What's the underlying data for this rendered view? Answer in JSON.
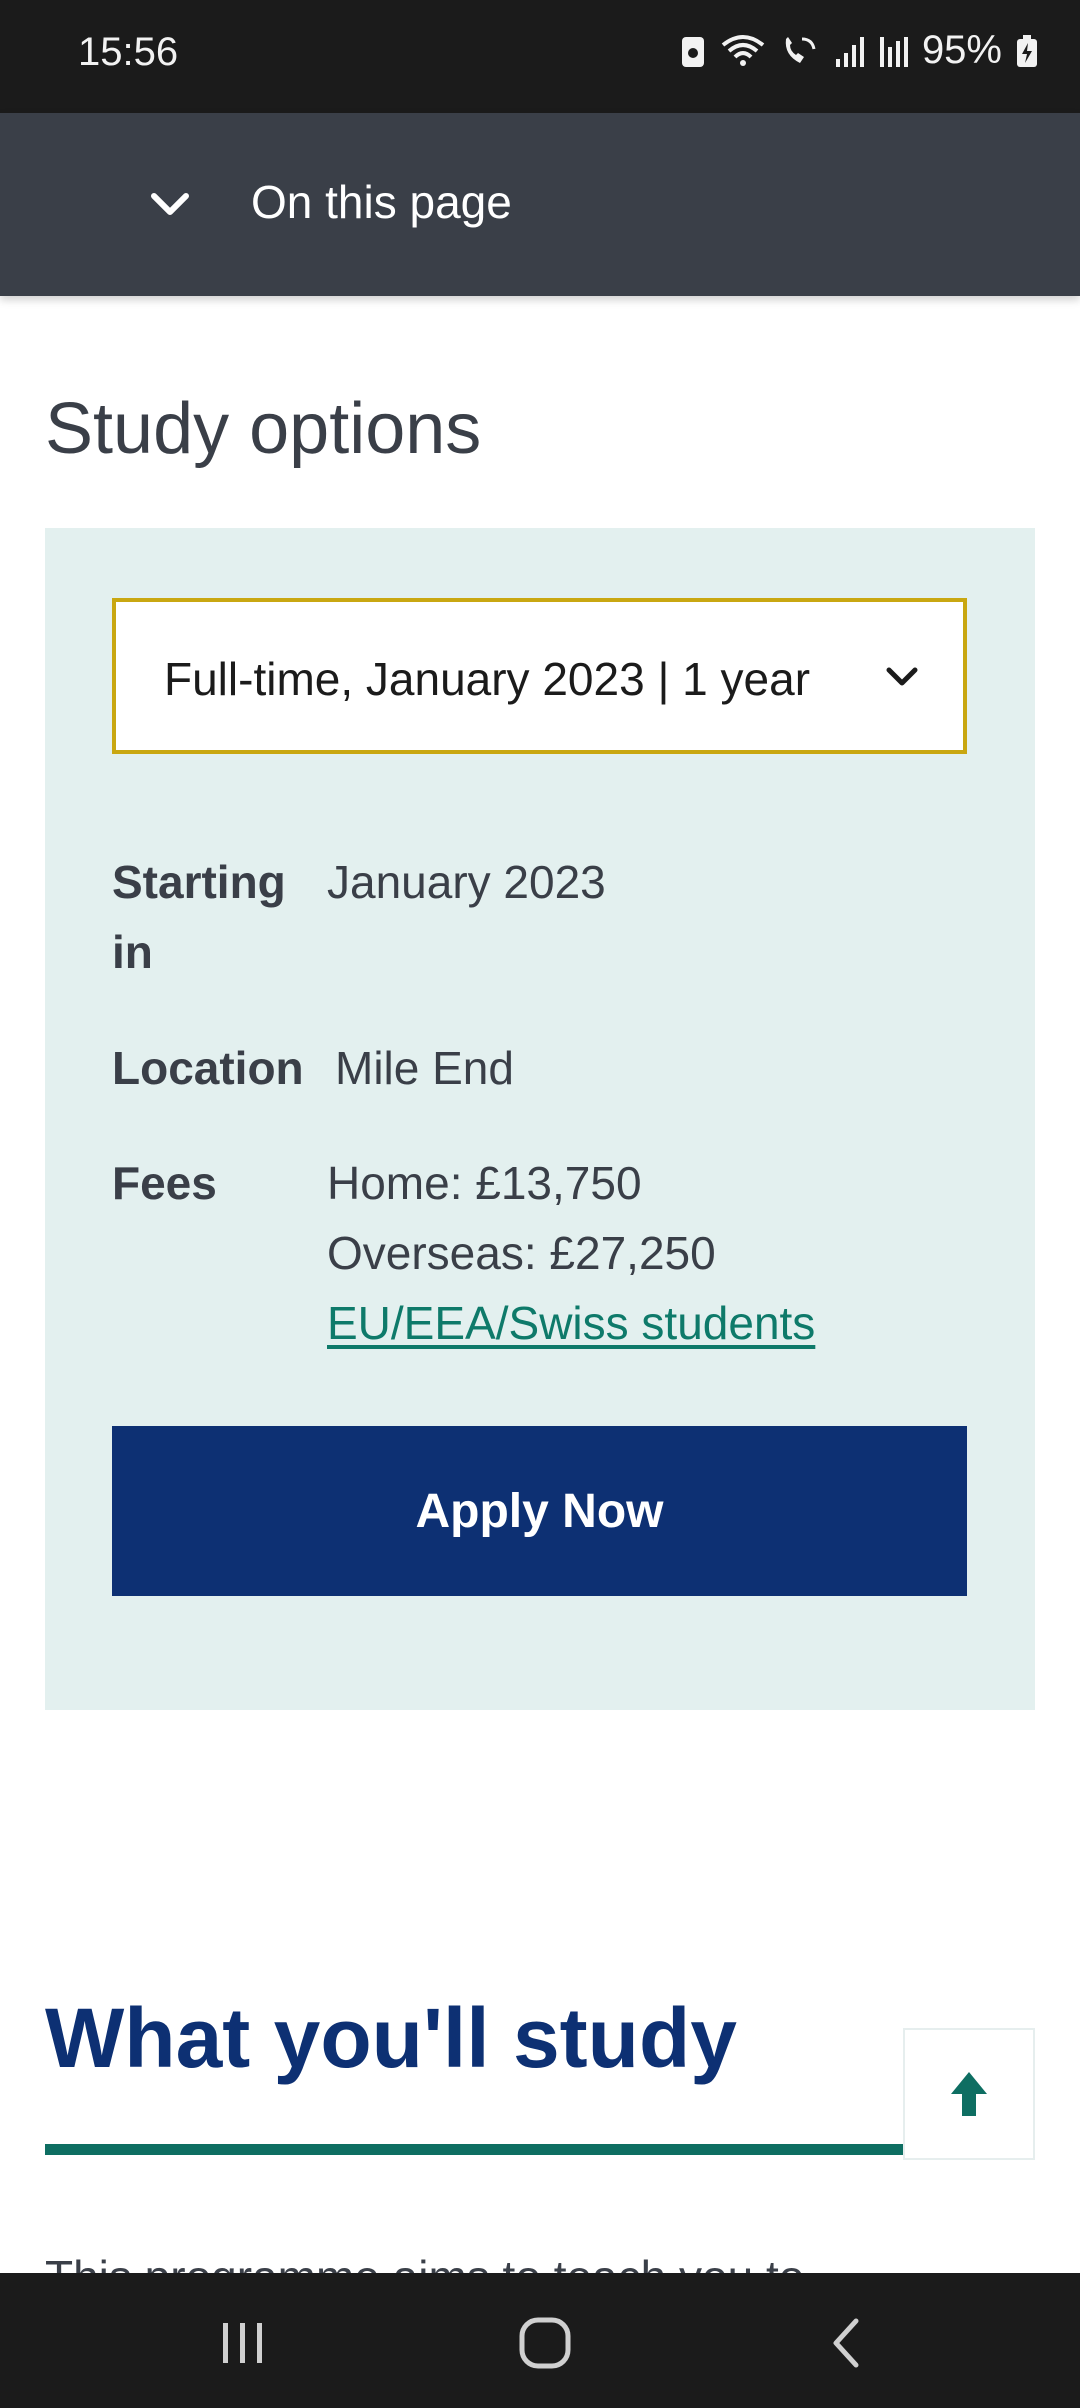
{
  "status_bar": {
    "time": "15:56",
    "battery_percent": "95%",
    "icons": [
      "sim-icon",
      "wifi-icon",
      "wifi-calling-icon",
      "signal-icon",
      "roaming-signal-icon",
      "battery-charging-icon"
    ]
  },
  "toc": {
    "label": "On this page",
    "icon": "chevron-down-icon"
  },
  "study_options": {
    "title": "Study options",
    "select_value": "Full-time, January 2023 | 1 year",
    "starting_label": "Starting in",
    "starting_value": "January 2023",
    "location_label": "Location",
    "location_value": "Mile End",
    "fees_label": "Fees",
    "fees_home": "Home: £13,750",
    "fees_overseas": "Overseas: £27,250",
    "fees_link": "EU/EEA/Swiss students",
    "apply_label": "Apply Now"
  },
  "study_section": {
    "heading": "What you'll study",
    "partial_text": "This programme aims to teach you to"
  },
  "colors": {
    "select_border": "#c9a711",
    "apply_bg": "#0d3073",
    "heading": "#0d3073",
    "accent_teal": "#0e6e62",
    "panel_bg": "#e3f0ef"
  }
}
